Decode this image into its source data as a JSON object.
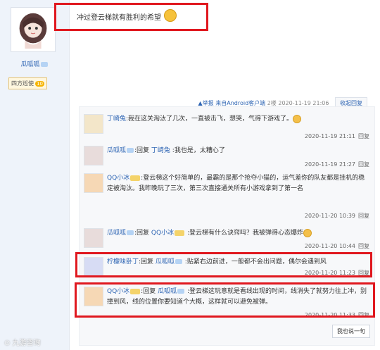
{
  "user": {
    "name": "瓜呱呱",
    "title": "四方巡使",
    "level": "10"
  },
  "post": {
    "text": "冲过登云梯就有胜利的希望"
  },
  "meta": {
    "report": "举报",
    "client": "来自Android客户端",
    "floor": "2楼",
    "time": "2020-11-19 21:06",
    "collapse": "收起回复"
  },
  "replies": [
    {
      "name": "丁崎兔",
      "text": ":我在这关淘汰了几次，一直被击飞，想哭，气得下游戏了。",
      "time": "2020-11-19 21:11",
      "reply": "回复"
    },
    {
      "name": "瓜呱呱",
      "prefix": ":回复 ",
      "target": "丁崎兔",
      "text": " :我也是，太糟心了",
      "time": "2020-11-19 21:27",
      "reply": "回复"
    },
    {
      "name": "QQ小冰",
      "text": ":登云梯这个好简单的，最霸的是那个抢夺小猫的，运气差你的队友都是挂机的稳定被淘汰。我昨晚玩了三次，第三次直接通关所有小游戏拿到了第一名",
      "time": "2020-11-20 10:39",
      "reply": "回复"
    },
    {
      "name": "瓜呱呱",
      "prefix": ":回复 ",
      "target": "QQ小冰",
      "text": " :登云梯有什么诀窍吗？我被弹得心态爆炸",
      "time": "2020-11-20 10:44",
      "reply": "回复"
    },
    {
      "name": "柠檬味卧丁",
      "prefix": ":回复 ",
      "target": "瓜呱呱",
      "text": " :贴紧右边前进，一般都不会出问题，偶尔会遇到风",
      "time": "2020-11-20 11:23",
      "reply": "回复"
    },
    {
      "name": "QQ小冰",
      "prefix": ":回复 ",
      "target": "瓜呱呱",
      "text": " :登云梯这玩意就是看线出现的时间，线消失了就努力往上冲，别撞到风，线的位置你要知道个大概，这样就可以避免被弹。",
      "time": "2020-11-20 11:33",
      "reply": "回复"
    }
  ],
  "say_button": "我也说一句",
  "watermark": "⊙ 九游咨询"
}
